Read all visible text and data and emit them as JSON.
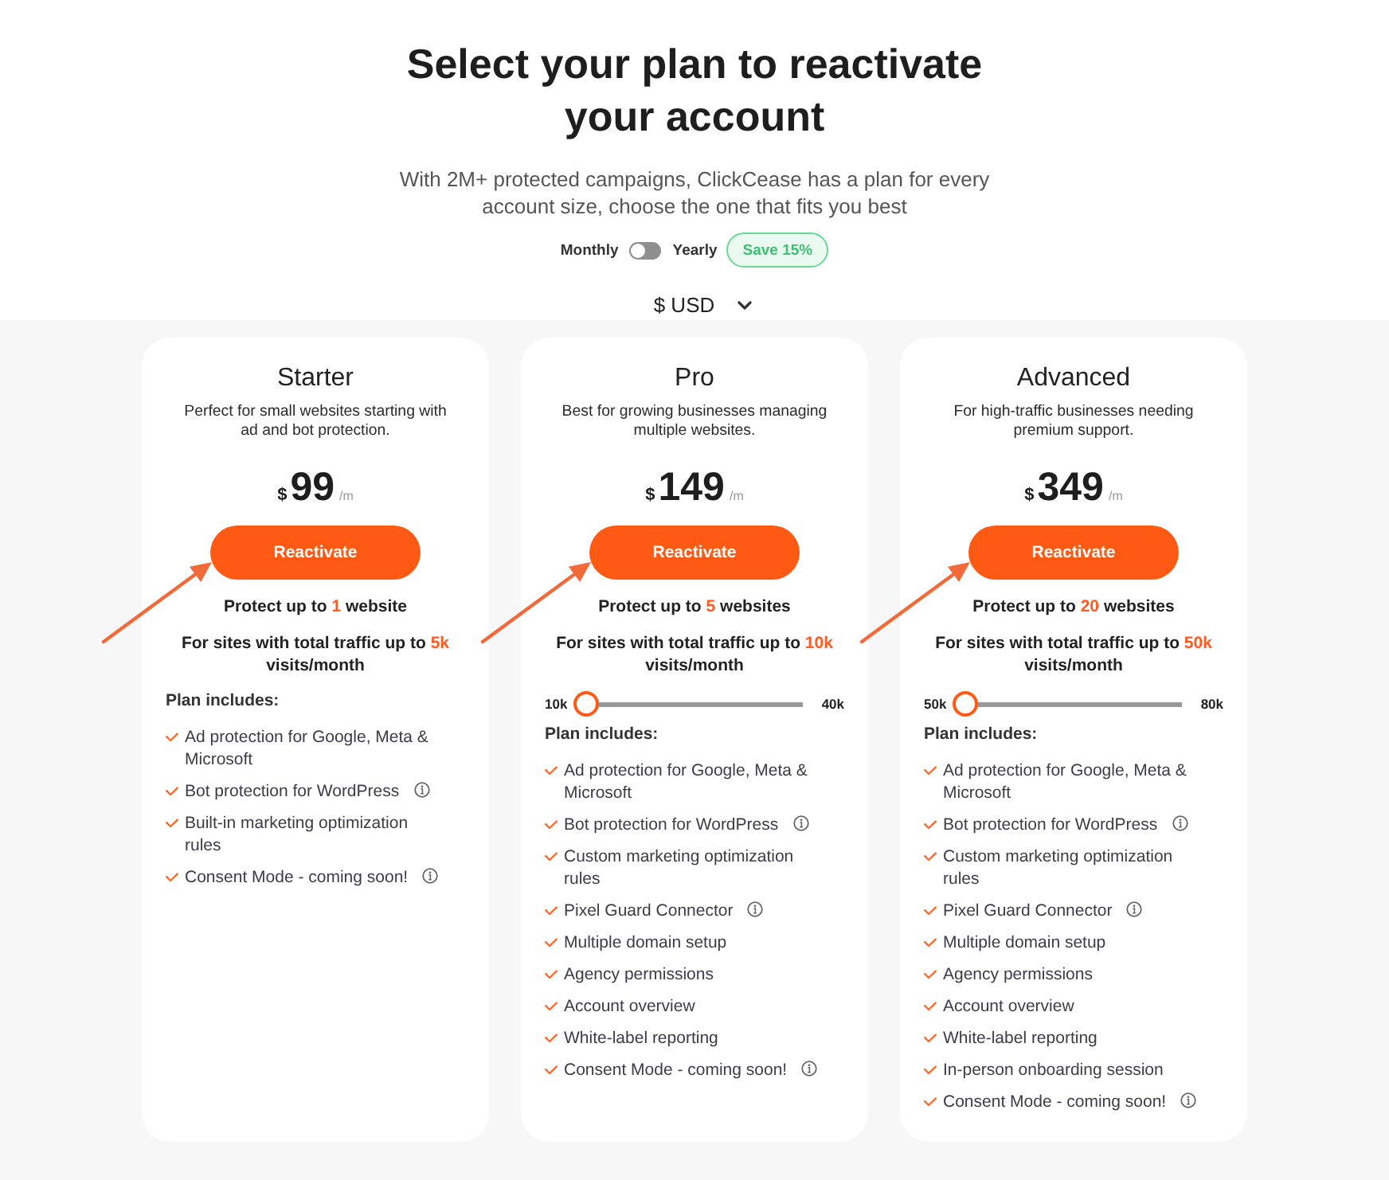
{
  "header": {
    "title": "Select your plan to reactivate your account",
    "subtitle": "With 2M+ protected campaigns, ClickCease has a plan for every account size, choose the one that fits you best"
  },
  "billing": {
    "monthly_label": "Monthly",
    "yearly_label": "Yearly",
    "yearly": false,
    "badge": "Save 15%"
  },
  "currency": {
    "value": "$ USD"
  },
  "plans": [
    {
      "name": "Starter",
      "description": "Perfect for small websites starting with ad and bot protection.",
      "currency": "$",
      "price": "99",
      "period": "/m",
      "button": "Reactivate",
      "pointer_arrow": true,
      "websites": "Protect up to **1** website",
      "traffic": "For sites with total traffic up to **5k** visits/month",
      "includes_label": "Plan includes:",
      "features": [
        {
          "text": "Ad protection for Google, Meta & Microsoft",
          "info": false
        },
        {
          "text": "Bot protection for WordPress",
          "info": true
        },
        {
          "text": "Built-in marketing optimization rules",
          "info": false
        },
        {
          "text": "Consent Mode - coming soon!",
          "info": true
        }
      ]
    },
    {
      "name": "Pro",
      "description": "Best for growing businesses managing multiple websites.",
      "currency": "$",
      "price": "149",
      "period": "/m",
      "button": "Reactivate",
      "pointer_arrow": true,
      "websites": "Protect up to **5** websites",
      "traffic": "For sites with total traffic up to **10k** visits/month",
      "slider": {
        "min_label": "10k",
        "max_label": "40k",
        "level": 0
      },
      "includes_label": "Plan includes:",
      "features": [
        {
          "text": "Ad protection for Google, Meta & Microsoft",
          "info": false
        },
        {
          "text": "Bot protection for WordPress",
          "info": true
        },
        {
          "text": "Custom marketing optimization rules",
          "info": false
        },
        {
          "text": "Pixel Guard Connector",
          "info": true
        },
        {
          "text": "Multiple domain setup",
          "info": false
        },
        {
          "text": "Agency permissions",
          "info": false
        },
        {
          "text": "Account overview",
          "info": false
        },
        {
          "text": "White-label reporting",
          "info": false
        },
        {
          "text": "Consent Mode - coming soon!",
          "info": true
        }
      ]
    },
    {
      "name": "Advanced",
      "description": "For high-traffic businesses needing premium support.",
      "currency": "$",
      "price": "349",
      "period": "/m",
      "button": "Reactivate",
      "pointer_arrow": true,
      "websites": "Protect up to **20** websites",
      "traffic": "For sites with total traffic up to **50k** visits/month",
      "slider": {
        "min_label": "50k",
        "max_label": "80k",
        "level": 0
      },
      "includes_label": "Plan includes:",
      "features": [
        {
          "text": "Ad protection for Google, Meta & Microsoft",
          "info": false
        },
        {
          "text": "Bot protection for WordPress",
          "info": true
        },
        {
          "text": "Custom marketing optimization rules",
          "info": false
        },
        {
          "text": "Pixel Guard Connector",
          "info": true
        },
        {
          "text": "Multiple domain setup",
          "info": false
        },
        {
          "text": "Agency permissions",
          "info": false
        },
        {
          "text": "Account overview",
          "info": false
        },
        {
          "text": "White-label reporting",
          "info": false
        },
        {
          "text": "In-person onboarding session",
          "info": false
        },
        {
          "text": "Consent Mode - coming soon!",
          "info": true
        }
      ]
    }
  ]
}
